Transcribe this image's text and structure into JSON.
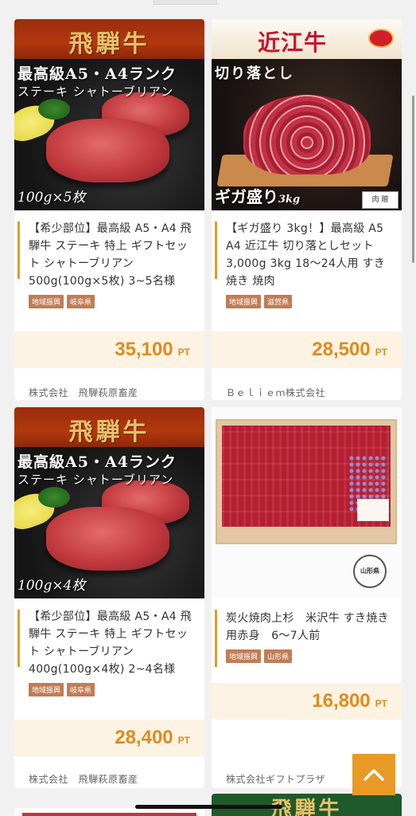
{
  "products": [
    {
      "photo": {
        "logo": "飛騨牛",
        "line1": "最高級A5・A4ランク",
        "line2": "ステーキ シャトーブリアン",
        "count": "100g×5枚"
      },
      "title": "【希少部位】最高級 A5・A4 飛騨牛 ステーキ 特上 ギフトセット シャトーブリアン 500g(100g×5枚) 3~5名様",
      "tags": [
        "地域振興",
        "岐阜県"
      ],
      "price": "35,100",
      "unit": "PT",
      "seller": "株式会社　飛騨萩原畜産"
    },
    {
      "photo": {
        "logo": "近江牛",
        "title": "切り落とし",
        "giga": "ギガ盛り",
        "giga_weight": "3kg",
        "sticker": "肉 贈"
      },
      "title": "【ギガ盛り 3kg！】最高級 A5 A4 近江牛 切り落としセット 3,000g 3kg 18～24人用 すき焼き 焼肉",
      "tags": [
        "地域振興",
        "滋賀県"
      ],
      "price": "28,500",
      "unit": "PT",
      "seller": "Ｂｅｌｉｅｍ株式会社"
    },
    {
      "photo": {
        "logo": "飛騨牛",
        "line1": "最高級A5・A4ランク",
        "line2": "ステーキ シャトーブリアン",
        "count": "100g×4枚"
      },
      "title": "【希少部位】最高級 A5・A4 飛騨牛 ステーキ 特上 ギフトセット シャトーブリアン 400g(100g×4枚) 2~4名様",
      "tags": [
        "地域振興",
        "岐阜県"
      ],
      "price": "28,400",
      "unit": "PT",
      "seller": "株式会社　飛騨萩原畜産"
    },
    {
      "photo": {
        "stamp": "山形県"
      },
      "title": "炭火焼肉上杉　米沢牛 すき焼き用赤身　6～7人前",
      "tags": [
        "地域振興",
        "山形県"
      ],
      "price": "16,800",
      "unit": "PT",
      "seller": "株式会社ギフトプラザ"
    }
  ],
  "peek": {
    "right_logo": "飛騨牛"
  },
  "back_to_top_icon": "chevron-up-icon",
  "colors": {
    "accent": "#e28a1e",
    "tag": "#c27c55",
    "price_bg": "#fcf3e2"
  }
}
